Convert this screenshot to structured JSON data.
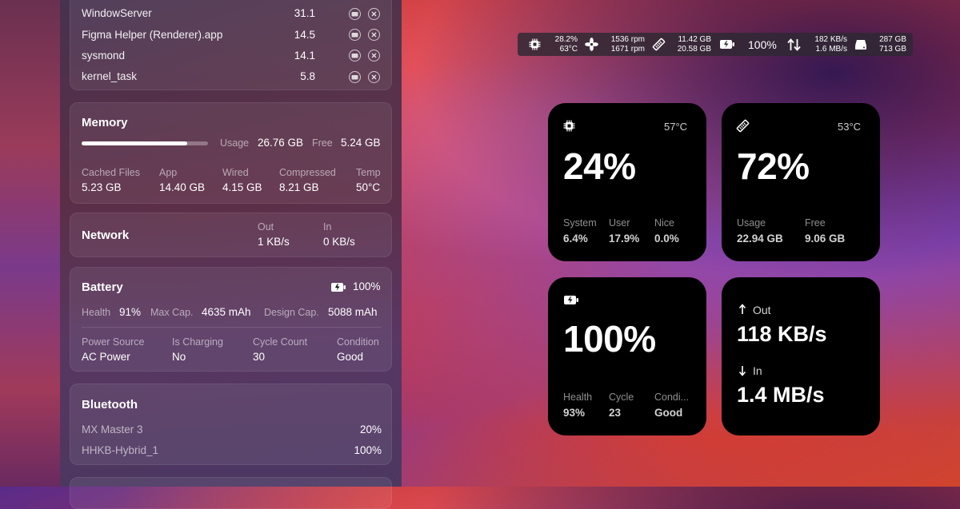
{
  "processes": [
    {
      "name": "WindowServer",
      "value": "31.1"
    },
    {
      "name": "Figma Helper (Renderer).app",
      "value": "14.5"
    },
    {
      "name": "sysmond",
      "value": "14.1"
    },
    {
      "name": "kernel_task",
      "value": "5.8"
    }
  ],
  "memory": {
    "title": "Memory",
    "usage_label": "Usage",
    "usage_value": "26.76 GB",
    "free_label": "Free",
    "free_value": "5.24 GB",
    "usage_fraction": 0.836,
    "stats": [
      {
        "label": "Cached Files",
        "value": "5.23 GB"
      },
      {
        "label": "App",
        "value": "14.40 GB"
      },
      {
        "label": "Wired",
        "value": "4.15 GB"
      },
      {
        "label": "Compressed",
        "value": "8.21 GB"
      },
      {
        "label": "Temp",
        "value": "50°C"
      }
    ]
  },
  "network": {
    "title": "Network",
    "out_label": "Out",
    "out_value": "1 KB/s",
    "in_label": "In",
    "in_value": "0 KB/s"
  },
  "battery": {
    "title": "Battery",
    "percent": "100%",
    "health_label": "Health",
    "health_value": "91%",
    "maxcap_label": "Max Cap.",
    "maxcap_value": "4635 mAh",
    "designcap_label": "Design Cap.",
    "designcap_value": "5088 mAh",
    "stats": [
      {
        "label": "Power Source",
        "value": "AC Power"
      },
      {
        "label": "Is Charging",
        "value": "No"
      },
      {
        "label": "Cycle Count",
        "value": "30"
      },
      {
        "label": "Condition",
        "value": "Good"
      }
    ]
  },
  "bluetooth": {
    "title": "Bluetooth",
    "devices": [
      {
        "name": "MX Master 3",
        "value": "20%"
      },
      {
        "name": "HHKB-Hybrid_1",
        "value": "100%"
      }
    ]
  },
  "menubar": {
    "cpu_load": "28.2%",
    "cpu_temp": "63°C",
    "fan1": "1536 rpm",
    "fan2": "1671 rpm",
    "mem_used": "11.42 GB",
    "mem_total": "20.58 GB",
    "battery": "100%",
    "net_out": "182 KB/s",
    "net_in": "1.6 MB/s",
    "disk_used": "287 GB",
    "disk_free": "713 GB"
  },
  "widgets": {
    "cpu": {
      "temp": "57°C",
      "value": "24%",
      "stats": [
        {
          "label": "System",
          "value": "6.4%"
        },
        {
          "label": "User",
          "value": "17.9%"
        },
        {
          "label": "Nice",
          "value": "0.0%"
        }
      ]
    },
    "memory": {
      "temp": "53°C",
      "value": "72%",
      "stats": [
        {
          "label": "Usage",
          "value": "22.94 GB"
        },
        {
          "label": "Free",
          "value": "9.06 GB"
        }
      ]
    },
    "battery": {
      "value": "100%",
      "stats": [
        {
          "label": "Health",
          "value": "93%"
        },
        {
          "label": "Cycle",
          "value": "23"
        },
        {
          "label": "Condi...",
          "value": "Good"
        }
      ]
    },
    "network": {
      "out_label": "Out",
      "out_value": "118 KB/s",
      "in_label": "In",
      "in_value": "1.4 MB/s"
    }
  }
}
